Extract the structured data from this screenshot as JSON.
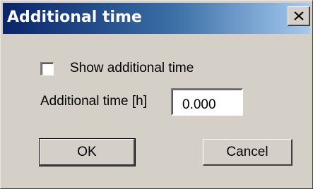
{
  "window": {
    "title": "Additional time",
    "close_label": "X"
  },
  "form": {
    "show_checkbox_label": "Show additional time",
    "show_checkbox_checked": false,
    "time_label": "Additional time [h]",
    "time_value": "0.000"
  },
  "buttons": {
    "ok_label": "OK",
    "cancel_label": "Cancel"
  },
  "icons": {
    "close": "close-icon"
  },
  "colors": {
    "title_bar_start": "#0a246a",
    "title_bar_end": "#a6caf0",
    "dialog_face": "#d4d0c8"
  }
}
